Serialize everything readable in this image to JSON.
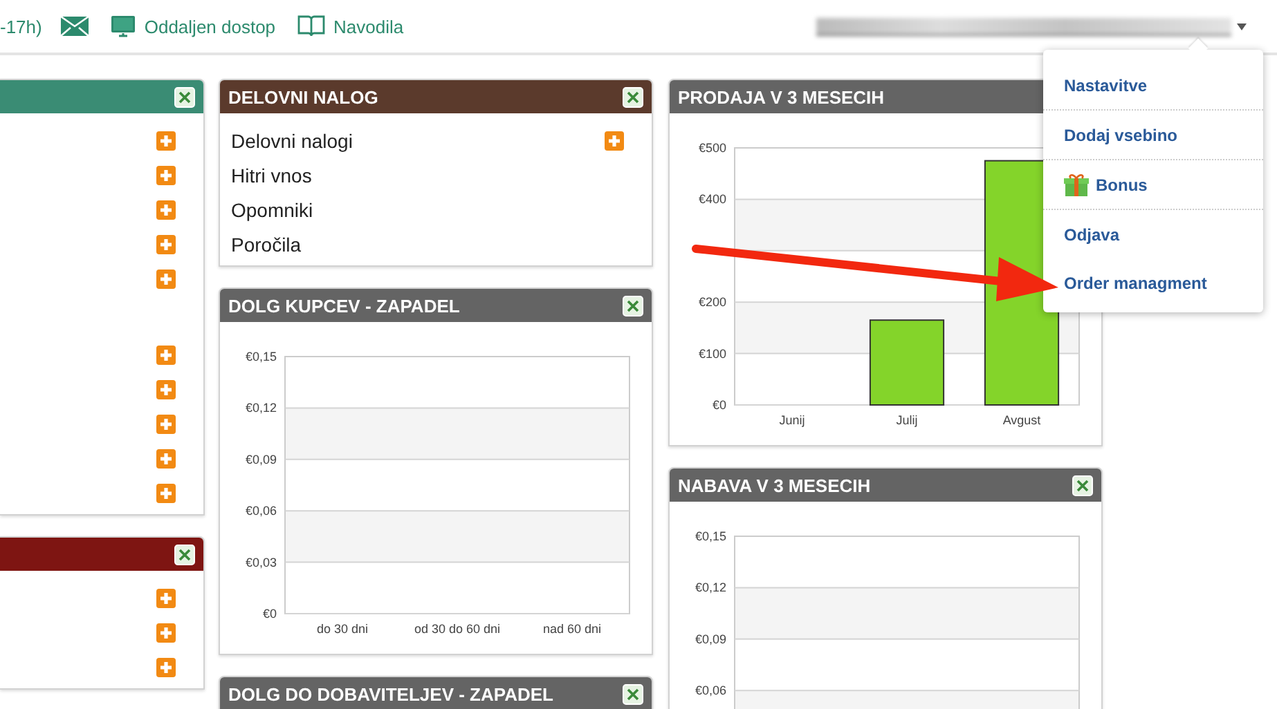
{
  "top_bar": {
    "hours_fragment": "-17h)",
    "links": [
      {
        "kind": "mail"
      },
      {
        "kind": "monitor",
        "label": "Oddaljen dostop"
      },
      {
        "kind": "book",
        "label": "Navodila"
      }
    ]
  },
  "user_menu": {
    "expanded": true,
    "items": [
      {
        "kind": "plain",
        "label": "Nastavitve"
      },
      {
        "kind": "plain",
        "label": "Dodaj vsebino"
      },
      {
        "kind": "gift",
        "label": "Bonus"
      },
      {
        "kind": "plain",
        "label": "Odjava"
      },
      {
        "kind": "plain",
        "label": "Order managment"
      }
    ]
  },
  "columns": [
    {
      "panels": [
        {
          "kind": "list",
          "color": "#3a8c74",
          "groups": [
            [
              {
                "add": true
              },
              {
                "add": true
              },
              {
                "add": true
              },
              {
                "add": true
              },
              {
                "add": true
              }
            ],
            [
              {
                "add": true
              },
              {
                "add": true
              },
              {
                "add": true
              },
              {
                "add": true
              },
              {
                "add": true
              }
            ]
          ]
        },
        {
          "kind": "list",
          "color": "#7e1512",
          "groups": [
            [
              {
                "add": true
              },
              {
                "add": true
              },
              {
                "add": true
              }
            ]
          ]
        }
      ]
    },
    {
      "panels": [
        {
          "kind": "list",
          "color": "#5b3a2c",
          "title": "DELOVNI NALOG",
          "groups": [
            [
              {
                "label": "Delovni nalogi",
                "add": true
              },
              {
                "label": "Hitri vnos",
                "add": false
              },
              {
                "label": "Opomniki",
                "add": false
              },
              {
                "label": "Poročila",
                "add": false
              }
            ]
          ]
        },
        {
          "kind": "chart",
          "color": "#646464",
          "title": "DOLG KUPCEV - ZAPADEL",
          "chart_data": {
            "type": "bar",
            "grid": true,
            "categories": [
              "do 30 dni",
              "od 30 do 60 dni",
              "nad 60 dni"
            ],
            "values": [
              0,
              0,
              0
            ],
            "ylim": [
              0,
              0.15
            ],
            "yticks": [
              {
                "value": 0,
                "label": "€0"
              },
              {
                "value": 0.03,
                "label": "€0,03"
              },
              {
                "value": 0.06,
                "label": "€0,06"
              },
              {
                "value": 0.09,
                "label": "€0,09"
              },
              {
                "value": 0.12,
                "label": "€0,12"
              },
              {
                "value": 0.15,
                "label": "€0,15"
              }
            ]
          }
        },
        {
          "kind": "chart",
          "color": "#646464",
          "title": "DOLG DO DOBAVITELJEV - ZAPADEL"
        }
      ]
    },
    {
      "panels": [
        {
          "kind": "chart",
          "color": "#646464",
          "title": "PRODAJA V 3 MESECIH",
          "chart_data": {
            "type": "bar",
            "grid": true,
            "categories": [
              "Junij",
              "Julij",
              "Avgust"
            ],
            "values": [
              0,
              165,
              475
            ],
            "ylim": [
              0,
              500
            ],
            "yticks": [
              {
                "value": 0,
                "label": "€0"
              },
              {
                "value": 100,
                "label": "€100"
              },
              {
                "value": 200,
                "label": "€200"
              },
              {
                "value": 400,
                "label": "€400"
              },
              {
                "value": 500,
                "label": "€500"
              }
            ]
          }
        },
        {
          "kind": "chart",
          "color": "#646464",
          "title": "NABAVA V 3 MESECIH",
          "chart_data": {
            "type": "bar",
            "grid": true,
            "categories": [
              null,
              null,
              null
            ],
            "ylim": [
              0,
              0.15
            ],
            "yticks": [
              {
                "value": 0.06,
                "label": "€0,06"
              },
              {
                "value": 0.09,
                "label": "€0,09"
              },
              {
                "value": 0.12,
                "label": "€0,12"
              },
              {
                "value": 0.15,
                "label": "€0,15"
              }
            ]
          }
        }
      ]
    }
  ]
}
